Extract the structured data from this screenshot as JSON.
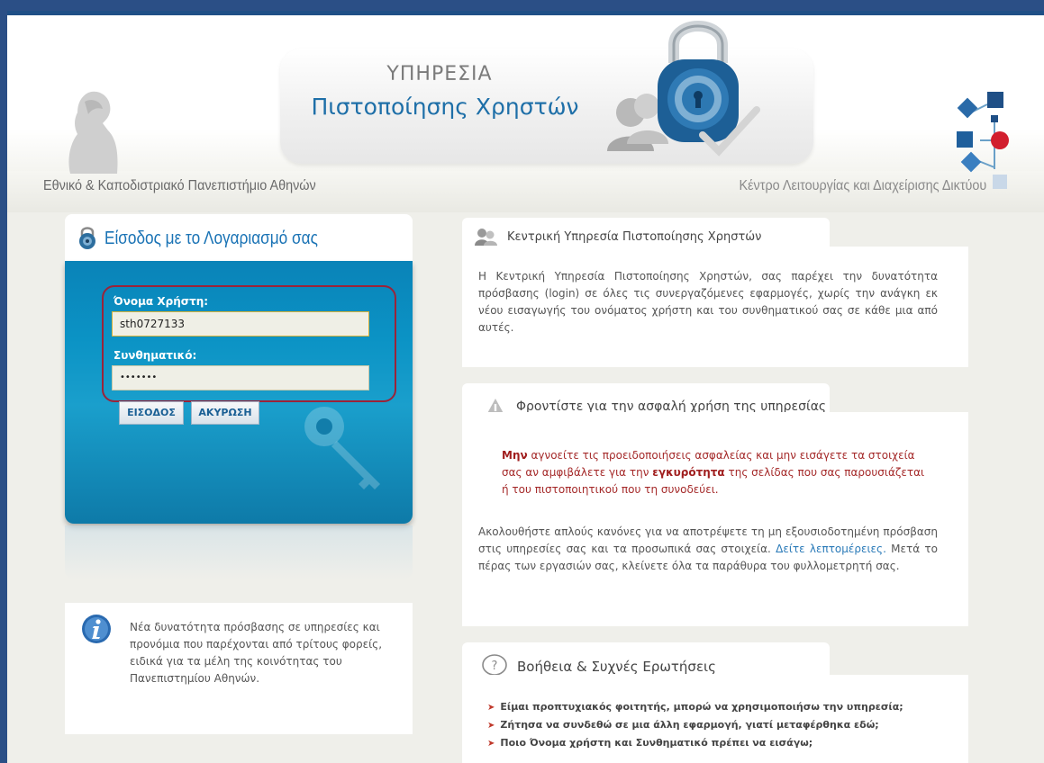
{
  "header": {
    "title_line1": "ΥΠΗΡΕΣΙΑ",
    "title_line2": "Πιστοποίησης Χρηστών",
    "university_name": "Εθνικό & Καποδιστριακό Πανεπιστήμιο Αθηνών",
    "center_name": "Κέντρο Λειτουργίας και Διαχείρισης Δικτύου"
  },
  "login": {
    "title": "Είσοδος με το Λογαριασμό σας",
    "username_label": "Όνομα Χρήστη:",
    "username_value": "sth0727133",
    "password_label": "Συνθηματικό:",
    "password_value": "•••••••",
    "submit_label": "ΕΙΣΟΔΟΣ",
    "cancel_label": "ΑΚΥΡΩΣΗ"
  },
  "info": {
    "text": "Νέα δυνατότητα πρόσβασης σε υπηρεσίες και προνόμια που παρέχονται από τρίτους φορείς, ειδικά για τα μέλη της κοινότητας του Πανεπιστημίου Αθηνών."
  },
  "central_service": {
    "title": "Κεντρική Υπηρεσία Πιστοποίησης Χρηστών",
    "text": "Η Κεντρική Υπηρεσία Πιστοποίησης Χρηστών, σας παρέχει την δυνατότητα πρόσβασης (login) σε όλες τις συνεργαζόμενες εφαρμογές, χωρίς την ανάγκη εκ νέου εισαγωγής του ονόματος χρήστη και του συνθηματικού σας σε κάθε μια από αυτές."
  },
  "safety": {
    "title": "Φροντίστε για την ασφαλή χρήση της υπηρεσίας",
    "warn_strong1": "Μην",
    "warn_text1": " αγνοείτε τις προειδοποιήσεις ασφαλείας και μην εισάγετε τα στοιχεία σας αν αμφιβάλετε για την ",
    "warn_strong2": "εγκυρότητα",
    "warn_text2": " της σελίδας που σας παρουσιάζεται ή του πιστοποιητικού που τη συνοδεύει.",
    "tips_text1": "Ακολουθήστε απλούς κανόνες για να αποτρέψετε τη μη εξουσιοδοτημένη πρόσβαση στις υπηρεσίες σας και τα προσωπικά σας στοιχεία. ",
    "tips_link": "Δείτε λεπτομέρειες.",
    "tips_text2": " Μετά το πέρας των εργασιών σας, κλείνετε όλα τα παράθυρα του φυλλομετρητή σας."
  },
  "help": {
    "title": "Βοήθεια & Συχνές Ερωτήσεις",
    "questions": [
      "Είμαι προπτυχιακός φοιτητής, μπορώ να χρησιμοποιήσω την υπηρεσία;",
      "Ζήτησα να συνδεθώ σε μια άλλη εφαρμογή, γιατί μεταφέρθηκα εδώ;",
      "Ποιο Όνομα χρήστη και Συνθηματικό πρέπει να εισάγω;"
    ]
  },
  "colors": {
    "border": "#2b4f86",
    "accent": "#1a73b5",
    "login_panel": "#0b93c5",
    "warning": "#a52a2a",
    "highlight_outline": "#9b2339"
  },
  "icons": [
    "lock-icon",
    "users-icon",
    "warning-icon",
    "help-icon",
    "info-icon",
    "key-icon",
    "padlock-icon"
  ]
}
